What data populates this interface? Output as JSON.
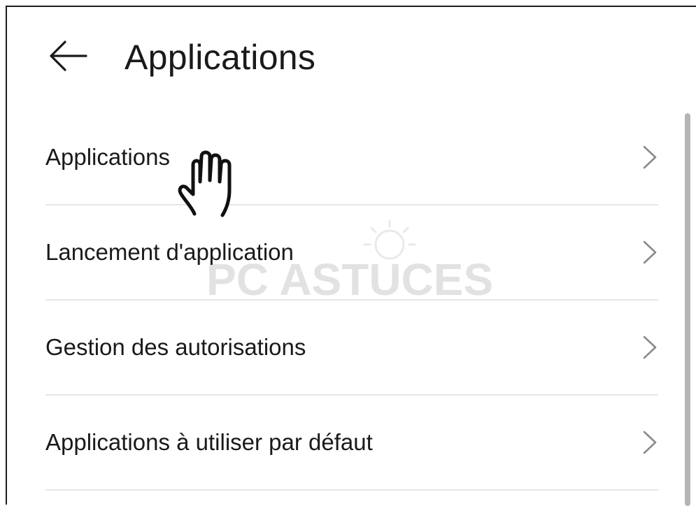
{
  "header": {
    "back_icon": "arrow-left-icon",
    "title": "Applications"
  },
  "menu": {
    "items": [
      {
        "label": "Applications",
        "icon": "chevron-right-icon"
      },
      {
        "label": "Lancement d'application",
        "icon": "chevron-right-icon"
      },
      {
        "label": "Gestion des autorisations",
        "icon": "chevron-right-icon"
      },
      {
        "label": "Applications à utiliser par défaut",
        "icon": "chevron-right-icon"
      }
    ]
  },
  "overlay": {
    "cursor_icon": "hand-pointer-icon",
    "watermark_text": "PC ASTUCES"
  },
  "colors": {
    "text": "#1a1a1a",
    "divider": "#e6e6e6",
    "chevron": "#8a8a8a",
    "scrollbar": "#b5b5b5"
  }
}
